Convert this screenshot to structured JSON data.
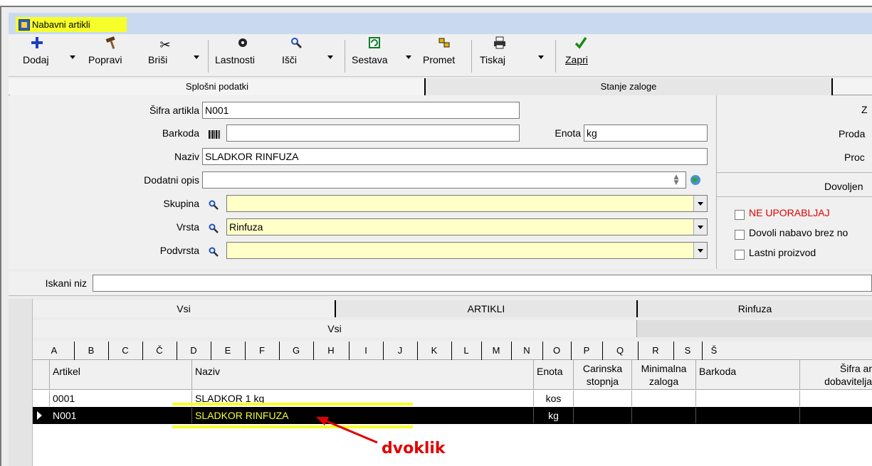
{
  "window": {
    "title": "Nabavni artikli"
  },
  "toolbar": [
    {
      "label": "Dodaj",
      "icon": "plus-icon",
      "has_dropdown": true
    },
    {
      "label": "Popravi",
      "icon": "hammer-icon",
      "has_dropdown": false
    },
    {
      "label": "Briši",
      "icon": "scissors-icon",
      "has_dropdown": true
    },
    {
      "label": "Lastnosti",
      "icon": "properties-icon",
      "has_dropdown": false
    },
    {
      "label": "Išči",
      "icon": "search-icon",
      "has_dropdown": true
    },
    {
      "label": "Sestava",
      "icon": "composition-icon",
      "has_dropdown": true
    },
    {
      "label": "Promet",
      "icon": "traffic-icon",
      "has_dropdown": false
    },
    {
      "label": "Tiskaj",
      "icon": "printer-icon",
      "has_dropdown": true
    },
    {
      "label": "Zapri",
      "icon": "checkmark-icon",
      "has_dropdown": false
    }
  ],
  "top_tabs": [
    "Splošni podatki",
    "Stanje zaloge"
  ],
  "form": {
    "sifra_label": "Šifra artikla",
    "sifra_value": "N001",
    "barkoda_label": "Barkoda",
    "barkoda_value": "",
    "enota_label": "Enota",
    "enota_value": "kg",
    "naziv_label": "Naziv",
    "naziv_value": "SLADKOR RINFUZA",
    "opis_label": "Dodatni opis",
    "opis_value": "",
    "skupina_label": "Skupina",
    "skupina_value": "",
    "vrsta_label": "Vrsta",
    "vrsta_value": "Rinfuza",
    "podvrsta_label": "Podvrsta",
    "podvrsta_value": ""
  },
  "right_panel": {
    "labels": [
      "Z",
      "Proda",
      "Proc"
    ],
    "section": "Dovoljen",
    "checkboxes": [
      {
        "label": "NE UPORABLJAJ",
        "checked": false,
        "color": "#e00000"
      },
      {
        "label": "Dovoli nabavo brez no",
        "checked": false,
        "color": "#000000"
      },
      {
        "label": "Lastni proizvod",
        "checked": false,
        "color": "#000000"
      }
    ]
  },
  "search": {
    "label": "Iskani niz",
    "value": ""
  },
  "grid_tabs": [
    "Vsi",
    "ARTIKLI",
    "Rinfuza"
  ],
  "grid_subtab": "Vsi",
  "letters": [
    "A",
    "B",
    "C",
    "Č",
    "D",
    "E",
    "F",
    "G",
    "H",
    "I",
    "J",
    "K",
    "L",
    "M",
    "N",
    "O",
    "P",
    "Q",
    "R",
    "S",
    "Š"
  ],
  "columns": {
    "artikel": "Artikel",
    "naziv": "Naziv",
    "enota": "Enota",
    "carinska_1": "Carinska",
    "carinska_2": "stopnja",
    "minimalna_1": "Minimalna",
    "minimalna_2": "zaloga",
    "barkoda": "Barkoda",
    "sifra_1": "Šifra ar",
    "sifra_2": "dobavitelja"
  },
  "rows": [
    {
      "artikel": "0001",
      "naziv": "SLADKOR 1 kg",
      "enota": "kos",
      "selected": false
    },
    {
      "artikel": "N001",
      "naziv": "SLADKOR RINFUZA",
      "enota": "kg",
      "selected": true
    }
  ],
  "annotation": {
    "text": "dvoklik",
    "color": "#e00000",
    "highlight": "#f7ff2a"
  }
}
